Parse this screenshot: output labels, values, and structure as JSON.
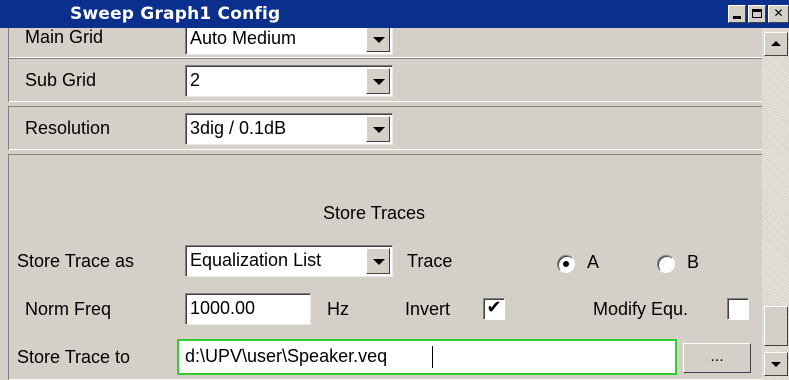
{
  "window": {
    "title": "Sweep Graph1 Config"
  },
  "rows": {
    "main_grid": {
      "label": "Main Grid",
      "value": "Auto Medium"
    },
    "sub_grid": {
      "label": "Sub Grid",
      "value": "2"
    },
    "resolution": {
      "label": "Resolution",
      "value": "3dig / 0.1dB"
    }
  },
  "store": {
    "heading": "Store Traces",
    "store_trace_as_label": "Store Trace as",
    "store_trace_as_value": "Equalization List",
    "trace_label": "Trace",
    "trace_a_label": "A",
    "trace_b_label": "B",
    "trace_selected": "A",
    "norm_freq_label": "Norm Freq",
    "norm_freq_value": "1000.00",
    "norm_freq_unit": "Hz",
    "invert_label": "Invert",
    "invert_checked": true,
    "modify_label": "Modify Equ.",
    "modify_checked": false,
    "store_to_label": "Store Trace to",
    "store_to_value": "d:\\UPV\\user\\Speaker.veq",
    "browse_label": "..."
  },
  "colors": {
    "titlebar": "#0b2f8c",
    "panel": "#d4d0c8",
    "focus_border": "#2fcf2f"
  }
}
